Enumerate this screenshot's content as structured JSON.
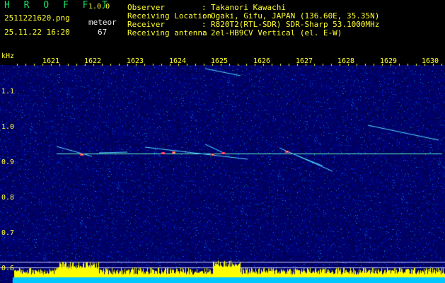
{
  "header": {
    "app_name": "H R O F F T",
    "version": "1.0.0",
    "filename": "2511221620.png",
    "datetime": "25.11.22 16:20",
    "meteor_label": "meteor",
    "meteor_count": "67"
  },
  "info": {
    "observer_label": "Observer",
    "observer_value": "Takanori Kawachi",
    "location_label": "Receiving Location",
    "location_value": "Ogaki, Gifu, JAPAN (136.60E, 35.35N)",
    "receiver_label": "Receiver",
    "receiver_value": "R820T2(RTL-SDR) SDR-Sharp 53.1000MHz",
    "antenna_label": "Receiving antenna",
    "antenna_value": "2el-HB9CV Vertical (el. E-W)",
    "separator": ":"
  },
  "axis": {
    "unit": "kHz",
    "time_ticks": [
      "1621",
      "1622",
      "1623",
      "1624",
      "1625",
      "1626",
      "1627",
      "1628",
      "1629",
      "1630"
    ],
    "freq_ticks": [
      "1.1",
      "1.0",
      "0.9",
      "0.8",
      "0.7",
      "0.6"
    ]
  },
  "colors": {
    "background": "#000000",
    "noise_base": "#00005a",
    "carrier": "#66ffcc",
    "text_green": "#19e36a",
    "text_yellow": "#ffff33",
    "level_bar": "#ffff00",
    "floor": "#00c8ff"
  }
}
